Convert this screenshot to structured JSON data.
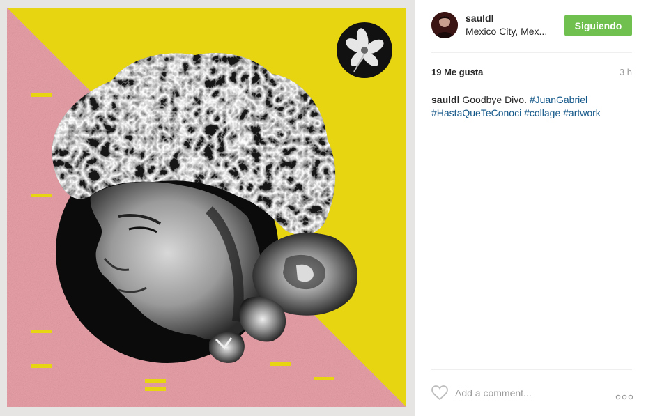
{
  "post": {
    "username": "sauldl",
    "location": "Mexico City, Mex...",
    "follow_label": "Siguiendo",
    "likes": "19 Me gusta",
    "time": "3 h",
    "caption": {
      "username": "sauldl",
      "text": "Goodbye Divo.",
      "hashtags": [
        "#JuanGabriel",
        "#HastaQueTeConoci",
        "#collage",
        "#artwork"
      ]
    },
    "comment_placeholder": "Add a comment...",
    "icons": {
      "like": "heart-icon",
      "more": "more-options-icon"
    }
  },
  "colors": {
    "artwork_yellow": "#e8d512",
    "artwork_pink": "#e8a0a8",
    "follow_green": "#70c050",
    "hashtag_blue": "#125688"
  }
}
